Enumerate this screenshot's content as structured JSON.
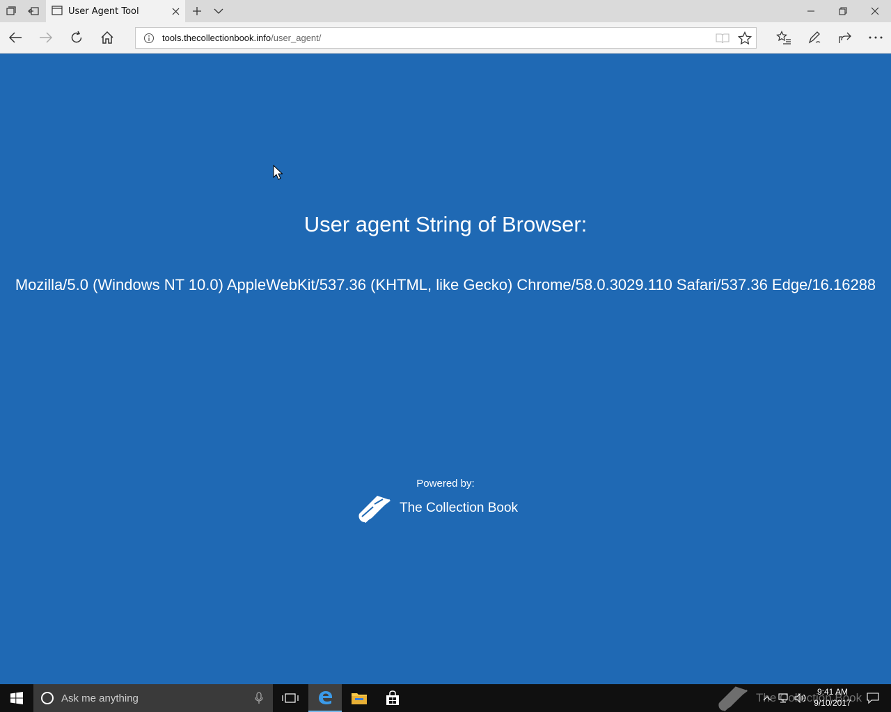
{
  "browser": {
    "tab_title": "User Agent Tool",
    "url_domain": "tools.thecollectionbook.info",
    "url_path": "/user_agent/"
  },
  "page": {
    "heading": "User agent String of Browser:",
    "user_agent": "Mozilla/5.0 (Windows NT 10.0) AppleWebKit/537.36 (KHTML, like Gecko) Chrome/58.0.3029.110 Safari/537.36 Edge/16.16288",
    "powered_by": "Powered by:",
    "brand_name": "The Collection Book",
    "background_color": "#1f69b4"
  },
  "taskbar": {
    "search_placeholder": "Ask me anything",
    "watermark": "The Collection Book",
    "time": "9:41 AM",
    "date": "9/10/2017",
    "pinned": [
      "task-view-icon",
      "edge-icon",
      "file-explorer-icon",
      "store-icon"
    ]
  }
}
